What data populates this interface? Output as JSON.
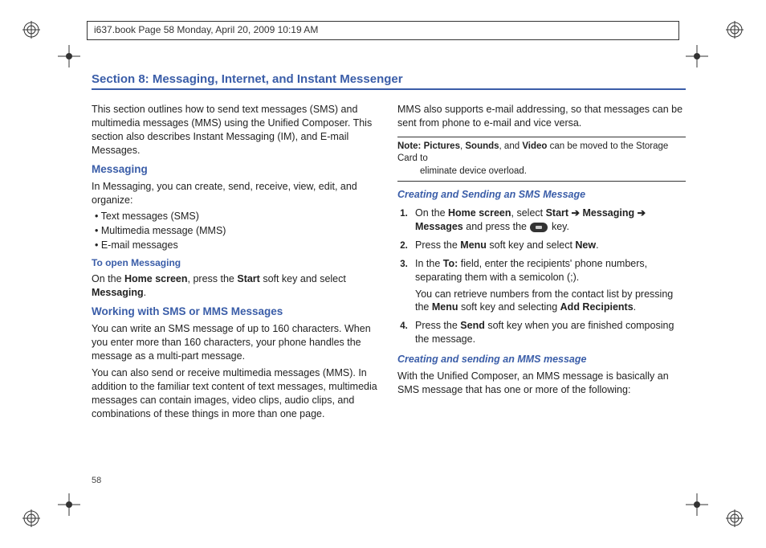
{
  "header": {
    "text": "i637.book  Page 58  Monday, April 20, 2009  10:19 AM"
  },
  "page_number": "58",
  "section_title": "Section 8: Messaging, Internet, and Instant Messenger",
  "left": {
    "intro": "This section outlines how to send text messages (SMS) and multimedia messages (MMS) using the Unified Composer. This section also describes Instant Messaging (IM), and E-mail Messages.",
    "h_messaging": "Messaging",
    "messaging_p": "In Messaging, you can create, send, receive, view, edit, and organize:",
    "b1": "• Text messages (SMS)",
    "b2": "• Multimedia message (MMS)",
    "b3": "• E-mail messages",
    "h_open": "To open Messaging",
    "open_p_pre": "On the ",
    "open_home": "Home screen",
    "open_mid": ", press the ",
    "open_start": "Start",
    "open_mid2": " soft key and select ",
    "open_messaging": "Messaging",
    "open_end": ".",
    "h_work": "Working with SMS or MMS Messages",
    "work_p1": "You can write an SMS message of up to 160 characters. When you enter more than 160 characters, your phone handles the message as a multi-part message.",
    "work_p2": "You can also send or receive multimedia messages (MMS). In addition to the familiar text content of text messages, multimedia messages can contain images, video clips, audio clips, and combinations of these things in more than one page."
  },
  "right": {
    "mms_p": "MMS also supports e-mail addressing, so that messages can be sent from phone to e-mail and vice versa.",
    "note_label": "Note:",
    "note_pic": "Pictures",
    "note_sep1": ", ",
    "note_snd": "Sounds",
    "note_sep2": ", and ",
    "note_vid": "Video",
    "note_rest": " can be moved to the Storage Card to ",
    "note_rest2": "eliminate device overload.",
    "h_sms": "Creating and Sending an SMS Message",
    "s1_pre": "On the ",
    "s1_home": "Home screen",
    "s1_mid": ", select ",
    "s1_start": "Start",
    "s1_arrow1": " ➔ ",
    "s1_msg": "Messaging",
    "s1_arrow2": " ➔ ",
    "s1_msgs": "Messages",
    "s1_mid2": " and press the ",
    "s1_key": " key.",
    "s2_pre": "Press the ",
    "s2_menu": "Menu",
    "s2_mid": " soft key and select ",
    "s2_new": "New",
    "s2_end": ".",
    "s3_pre": "In the ",
    "s3_to": "To:",
    "s3_rest": " field, enter the recipients' phone numbers, separating them with a semicolon (;).",
    "s3_sub_pre": "You can retrieve numbers from the contact list by pressing the ",
    "s3_sub_menu": "Menu",
    "s3_sub_mid": " soft key and selecting ",
    "s3_sub_add": "Add Recipients",
    "s3_sub_end": ".",
    "s4_pre": "Press the ",
    "s4_send": "Send",
    "s4_rest": " soft key when you are finished composing the message.",
    "h_mms": "Creating and sending an MMS message",
    "mms_p2": "With the Unified Composer, an MMS message is basically an SMS message that has one or more of the following:"
  }
}
